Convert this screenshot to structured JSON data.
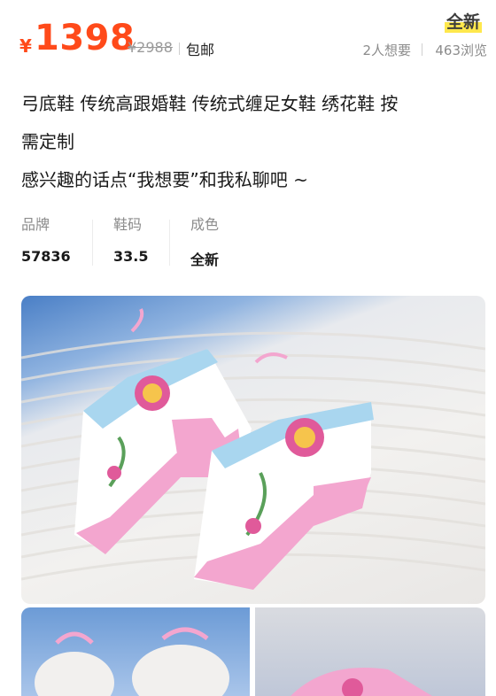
{
  "price": {
    "currency": "¥",
    "amount": "1398",
    "original": "¥2988",
    "shipping": "包邮"
  },
  "condition_badge": "全新",
  "stats": {
    "wants": "2人想要",
    "views": "463浏览"
  },
  "title": {
    "line1": "弓底鞋 传统高跟婚鞋 传统式缠足女鞋 绣花鞋 按",
    "line2": "需定制",
    "line3": "感兴趣的话点“我想要”和我私聊吧 ~"
  },
  "attributes": [
    {
      "label": "品牌",
      "value": "57836"
    },
    {
      "label": "鞋码",
      "value": "33.5"
    },
    {
      "label": "成色",
      "value": "全新"
    }
  ],
  "colors": {
    "price": "#ff4a1a",
    "badge_highlight": "#ffe84d",
    "shoe_pink": "#f3a6cf",
    "shoe_blue": "#a9d6ef"
  }
}
